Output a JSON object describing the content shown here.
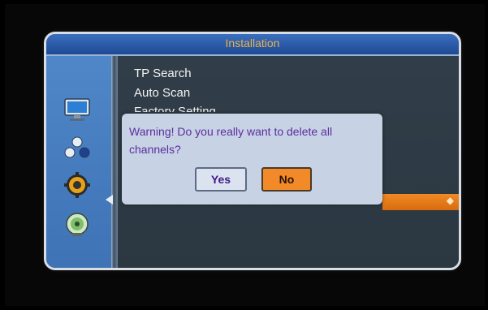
{
  "window": {
    "title": "Installation"
  },
  "sidebar": {
    "icons": [
      "monitor-icon",
      "network-icon",
      "gear-icon",
      "disc-icon"
    ],
    "selected": "disc-icon"
  },
  "menu": {
    "items": [
      {
        "label": "TP Search"
      },
      {
        "label": "Auto Scan"
      },
      {
        "label": "Factory Setting"
      }
    ]
  },
  "dialog": {
    "message": "Warning! Do you really want to delete all channels?",
    "yes_label": "Yes",
    "no_label": "No",
    "focused_button": "No"
  },
  "colors": {
    "title_text": "#e9b24a",
    "accent_orange": "#f08a24",
    "dialog_bg": "#c7d2e4",
    "message_text": "#5b2ea0",
    "sidebar_blue": "#4f87c8"
  }
}
